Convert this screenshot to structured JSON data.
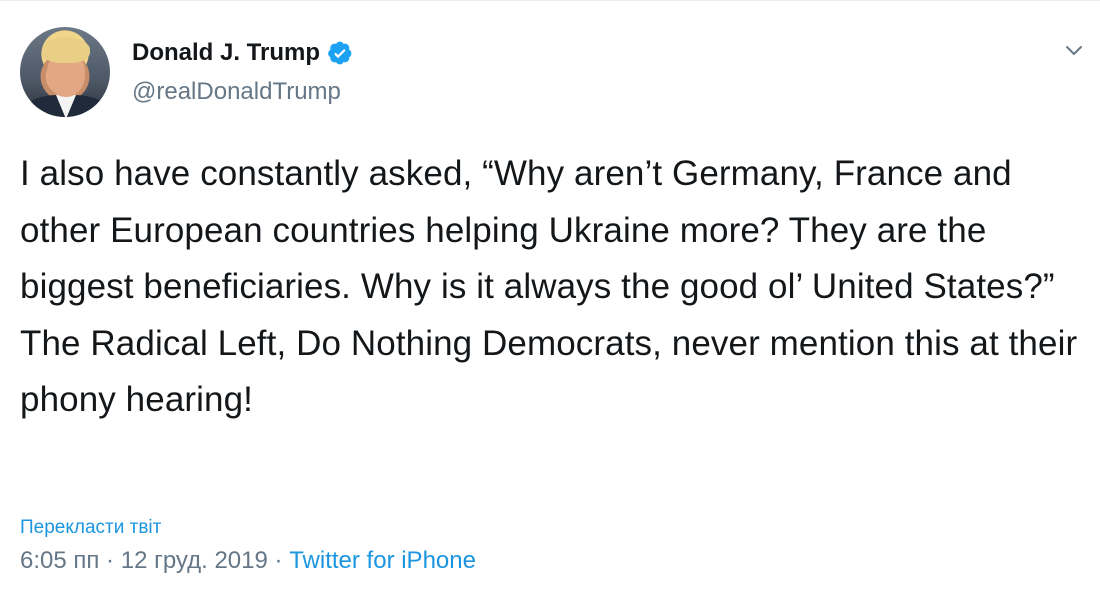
{
  "tweet": {
    "display_name": "Donald J. Trump",
    "handle": "@realDonaldTrump",
    "verified_icon": "verified-badge-icon",
    "menu_icon": "chevron-down-icon",
    "text": "I also have constantly asked, “Why aren’t Germany, France and other European countries helping Ukraine more? They are the biggest beneficiaries. Why is it always the good ol’ United States?” The Radical Left, Do Nothing Democrats, never mention this at their phony hearing!",
    "translate_label": "Перекласти твіт",
    "time": "6:05 пп",
    "date": "12 груд. 2019",
    "separator": "·",
    "source": "Twitter for iPhone"
  },
  "colors": {
    "text": "#14171a",
    "secondary": "#657786",
    "link": "#1b95e0",
    "verified": "#1da1f2"
  }
}
